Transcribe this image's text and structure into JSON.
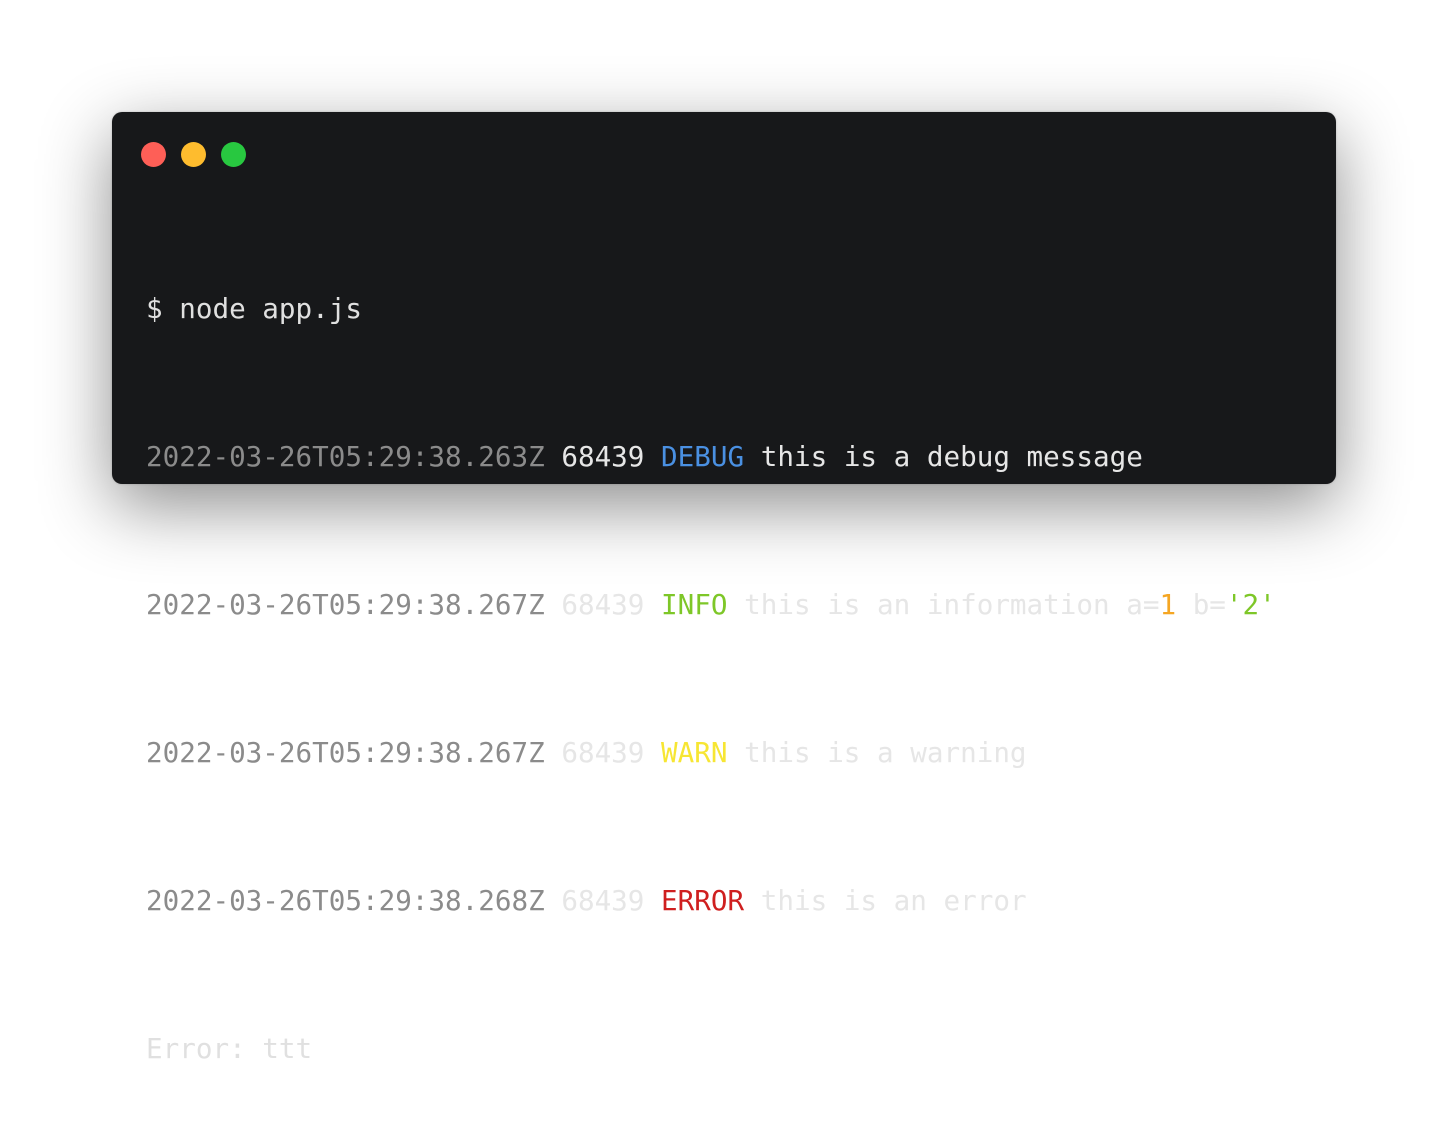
{
  "window": {
    "background": "#17181a",
    "controls": [
      {
        "name": "close",
        "color": "#fe5f57"
      },
      {
        "name": "minimize",
        "color": "#febc2e"
      },
      {
        "name": "zoom",
        "color": "#28c840"
      }
    ]
  },
  "colors": {
    "timestamp": "#8b8b8b",
    "debug": "#4a90e2",
    "info": "#7ec728",
    "warn": "#f7e633",
    "error": "#cf1f1f",
    "number": "#f5a623",
    "string": "#7ec728"
  },
  "terminal": {
    "command": "$ node app.js",
    "logs": [
      {
        "timestamp": "2022-03-26T05:29:38.263Z",
        "pid": "68439",
        "level": "DEBUG",
        "message": "this is a debug message"
      },
      {
        "timestamp": "2022-03-26T05:29:38.267Z",
        "pid": "68439",
        "level": "INFO",
        "message": "this is an information a=",
        "num": "1",
        "mid": " b=",
        "str": "'2'"
      },
      {
        "timestamp": "2022-03-26T05:29:38.267Z",
        "pid": "68439",
        "level": "WARN",
        "message": "this is a warning"
      },
      {
        "timestamp": "2022-03-26T05:29:38.268Z",
        "pid": "68439",
        "level": "ERROR",
        "message": "this is an error"
      }
    ],
    "error_line": "Error: ttt"
  }
}
